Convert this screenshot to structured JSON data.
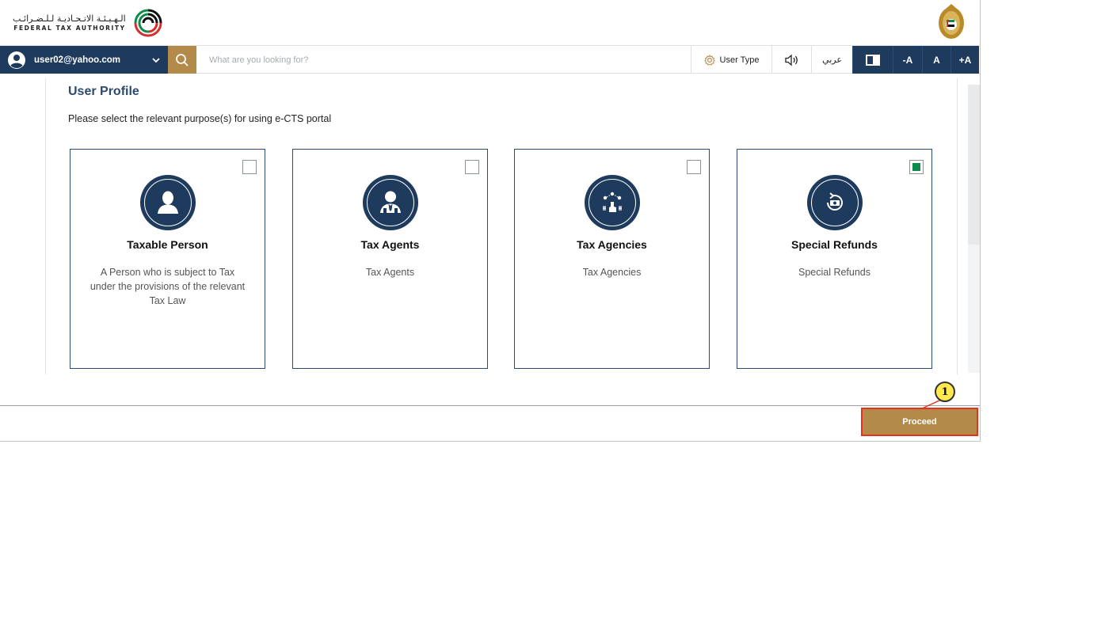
{
  "header": {
    "logo_arabic": "الـهـيـئـة الاتـحـاديـة لـلـضـرائـب",
    "logo_english": "FEDERAL TAX AUTHORITY",
    "emblem_icon": "uae-emblem-icon"
  },
  "navbar": {
    "user_email": "user02@yahoo.com",
    "search_placeholder": "What are you looking for?",
    "user_type_label": "User Type",
    "arabic_label": "عربي",
    "font_decrease": "-A",
    "font_normal": "A",
    "font_increase": "+A"
  },
  "page": {
    "title": "User Profile",
    "subtitle": "Please select the relevant purpose(s) for using e-CTS portal"
  },
  "cards": [
    {
      "title": "Taxable Person",
      "description": "A Person who is subject to Tax under the provisions of the relevant Tax Law",
      "checked": false,
      "icon": "person-icon"
    },
    {
      "title": "Tax Agents",
      "description": "Tax Agents",
      "checked": false,
      "icon": "agent-icon"
    },
    {
      "title": "Tax Agencies",
      "description": "Tax Agencies",
      "checked": false,
      "icon": "agency-icon"
    },
    {
      "title": "Special Refunds",
      "description": "Special Refunds",
      "checked": true,
      "icon": "refund-icon"
    }
  ],
  "footer": {
    "proceed_label": "Proceed",
    "callout_number": "1"
  },
  "colors": {
    "navy": "#1e3a5c",
    "gold": "#b38a4a",
    "check_green": "#0e8a4e",
    "highlight_red": "#e0341e"
  }
}
